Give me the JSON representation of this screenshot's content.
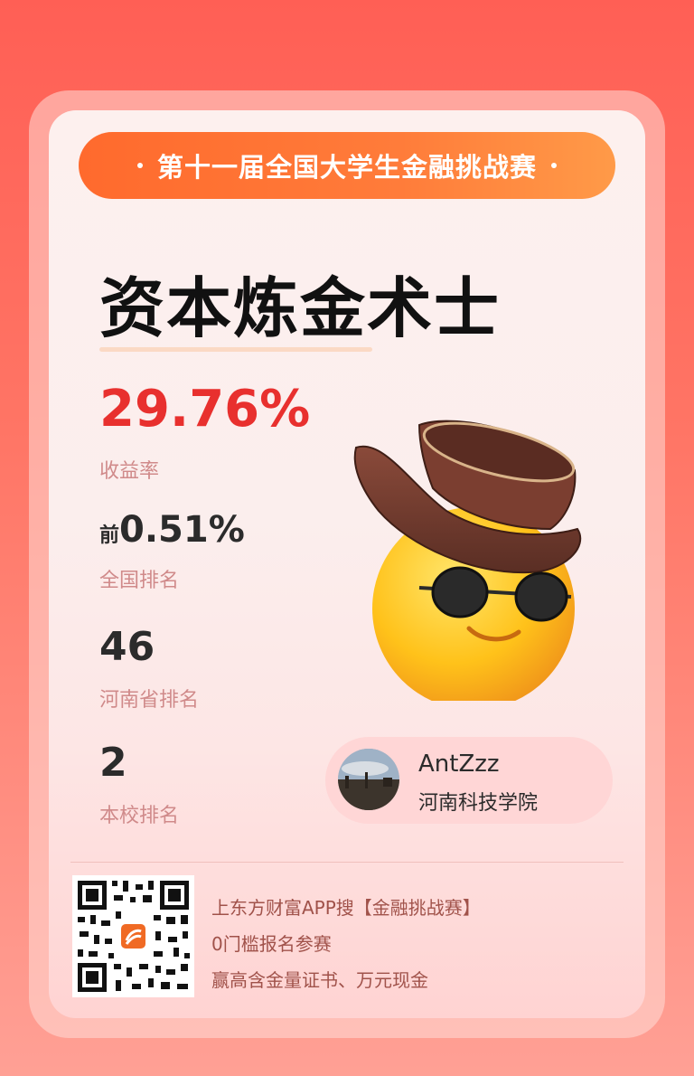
{
  "banner": {
    "text": "第十一届全国大学生金融挑战赛"
  },
  "title": "资本炼金术士",
  "stats": {
    "return_value": "29.76%",
    "return_label": "收益率",
    "national_prefix": "前",
    "national_value": "0.51%",
    "national_label": "全国排名",
    "province_value": "46",
    "province_label": "河南省排名",
    "school_value": "2",
    "school_label": "本校排名"
  },
  "user": {
    "name": "AntZzz",
    "school": "河南科技学院"
  },
  "promo": {
    "line1": "上东方财富APP搜【金融挑战赛】",
    "line2": "0门槛报名参赛",
    "line3": "赢高含金量证书、万元现金"
  },
  "colors": {
    "accent_red": "#e8302e",
    "banner_orange": "#ff6a2d",
    "label_pink": "#d08a8a"
  },
  "icons": {
    "mascot": "cowboy-hat-sunglasses-emoji",
    "qr": "qr-code-icon"
  }
}
